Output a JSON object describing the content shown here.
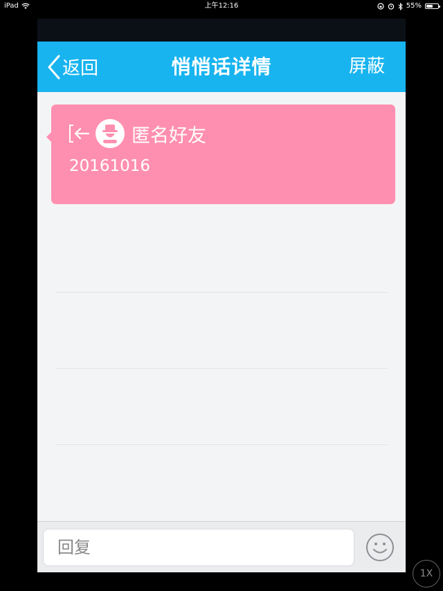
{
  "status_bar": {
    "device": "iPad",
    "time": "上午12:16",
    "battery": "55%",
    "battery_level": 0.55
  },
  "nav": {
    "back_label": "返回",
    "title": "悄悄话详情",
    "action_label": "屏蔽"
  },
  "message": {
    "sender": "匿名好友",
    "text": "20161016"
  },
  "reply": {
    "placeholder": "回复"
  },
  "overlay": {
    "speed_label": "1X"
  },
  "colors": {
    "nav_bg": "#18b4ef",
    "card_bg": "#ff8fb0",
    "content_bg": "#f3f4f6"
  },
  "icons": [
    "wifi-icon",
    "lock-rotation-icon",
    "alarm-icon",
    "bluetooth-icon",
    "battery-icon",
    "back-chevron-icon",
    "exit-arrow-icon",
    "anonymous-avatar-icon",
    "emoji-icon"
  ]
}
